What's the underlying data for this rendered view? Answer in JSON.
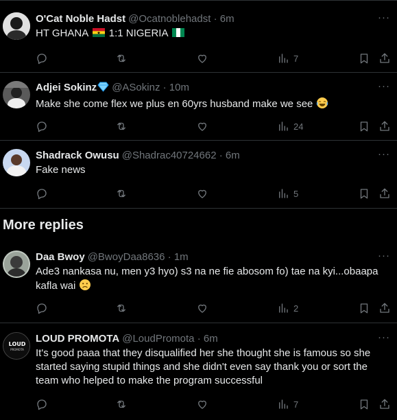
{
  "tweets": [
    {
      "name": "O'Cat Noble Hadst",
      "handle": "@Ocatnoblehadst",
      "sep": "·",
      "time": "6m",
      "text_a": "HT GHANA",
      "text_b": "1:1 NIGERIA",
      "views": "7"
    },
    {
      "name": "Adjei Sokinz",
      "handle": "@ASokinz",
      "sep": "·",
      "time": "10m",
      "text": "Make she come flex we plus en 60yrs husband make we see",
      "views": "24"
    },
    {
      "name": "Shadrack Owusu",
      "handle": "@Shadrac40724662",
      "sep": "·",
      "time": "6m",
      "text": "Fake news",
      "views": "5"
    }
  ],
  "more_replies_title": "More replies",
  "more_tweets": [
    {
      "name": "Daa Bwoy",
      "handle": "@BwoyDaa8636",
      "sep": "·",
      "time": "1m",
      "text_line1": "Ade3 nankasa nu, men y3 hyo) s3 na ne fie abosom fo) tae na kyi...obaapa",
      "text_line2": "kafla wai",
      "views": "2"
    },
    {
      "name": "LOUD PROMOTA",
      "handle": "@LoudPromota",
      "sep": "·",
      "time": "6m",
      "text": "It's good paaa that they disqualified her she thought she is famous so she started saying stupid things and she didn't even say thank you or sort the team who helped to make the program successful",
      "views": "7",
      "avatar_logo_text": "LOUD PROMOTA"
    }
  ],
  "icons": {
    "reply": "reply-icon",
    "retweet": "retweet-icon",
    "like": "like-icon",
    "views": "views-icon",
    "bookmark": "bookmark-icon",
    "share": "share-icon",
    "more": "more-icon"
  },
  "colors": {
    "background": "#000000",
    "text": "#e7e9ea",
    "secondary": "#71767b",
    "divider": "#2f3336",
    "verified": "#1d9bf0"
  },
  "more_glyph": "···"
}
